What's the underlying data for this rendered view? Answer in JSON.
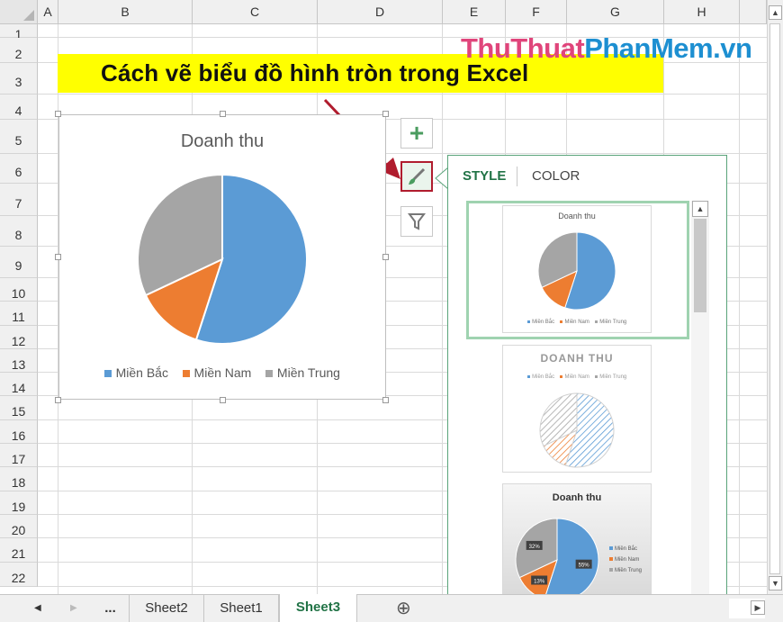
{
  "sheet": {
    "columns": [
      "A",
      "B",
      "C",
      "D",
      "E",
      "F",
      "G",
      "H"
    ],
    "rows": [
      "1",
      "2",
      "3",
      "4",
      "5",
      "6",
      "7",
      "8",
      "9",
      "10",
      "11",
      "12",
      "13",
      "14",
      "15",
      "16",
      "17",
      "18",
      "19",
      "20",
      "21",
      "22"
    ]
  },
  "title": "Cách vẽ biểu đồ hình tròn trong Excel",
  "logo": {
    "part1": "ThuThuat",
    "part2": "PhanMem",
    "part3": ".vn",
    "color1": "#e0457b",
    "color2": "#1d8fd1"
  },
  "chart": {
    "title": "Doanh thu",
    "colors": [
      "#5b9bd5",
      "#ed7d31",
      "#a5a5a5"
    ]
  },
  "chart_data": {
    "type": "pie",
    "title": "Doanh thu",
    "categories": [
      "Miền Bắc",
      "Miền Nam",
      "Miền Trung"
    ],
    "values": [
      55,
      13,
      32
    ],
    "legend": "bottom"
  },
  "side_buttons": {
    "add": "+",
    "style": "chart-styles",
    "filter": "chart-filters"
  },
  "panel": {
    "tabs": [
      "STYLE",
      "COLOR"
    ],
    "styles": [
      {
        "title": "Doanh thu"
      },
      {
        "title": "DOANH THU"
      },
      {
        "title": "Doanh thu",
        "labels": [
          "55%",
          "13%",
          "32%"
        ]
      }
    ],
    "legend_small": [
      "Miền Bắc",
      "Miền Nam",
      "Miền Trung"
    ]
  },
  "tabs": {
    "nav_more": "...",
    "sheets": [
      "Sheet2",
      "Sheet1",
      "Sheet3"
    ],
    "active": "Sheet3",
    "add": "⊕"
  }
}
